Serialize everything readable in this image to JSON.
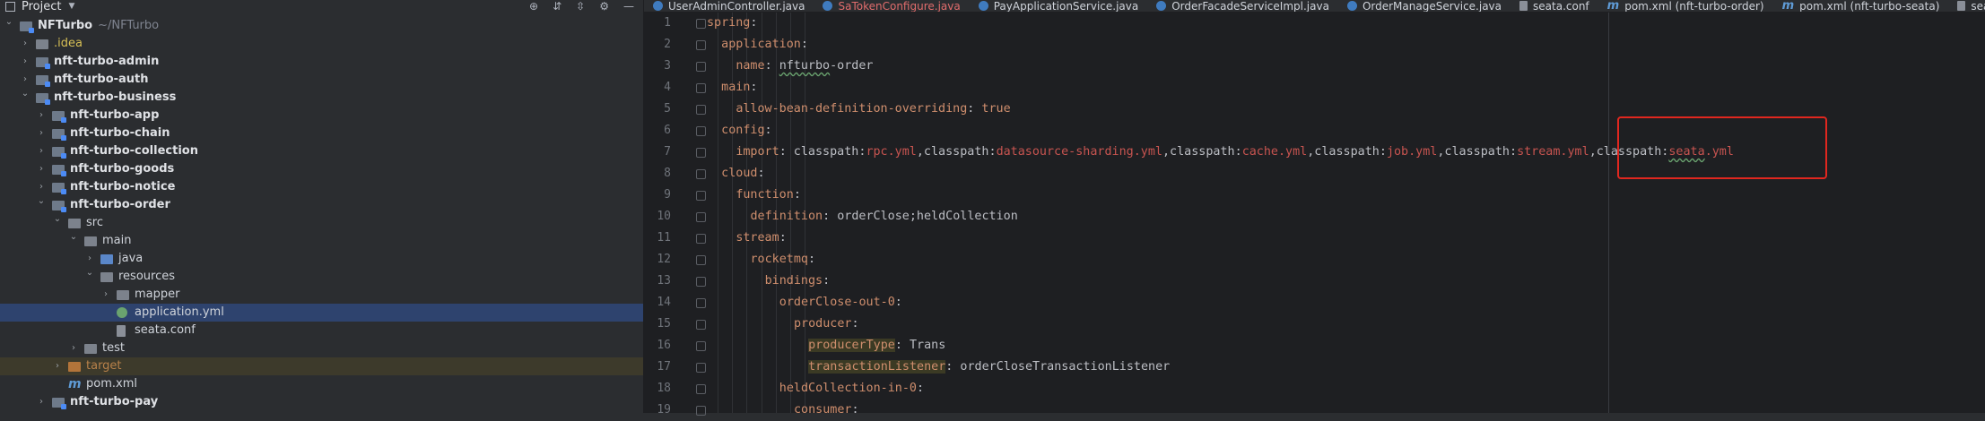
{
  "project": {
    "title": "Project",
    "tree": [
      {
        "label": "NFTurbo",
        "path": "~/NFTurbo",
        "depth": 0,
        "arrow": "open",
        "icon": "module",
        "bold": true
      },
      {
        "label": ".idea",
        "depth": 1,
        "arrow": "closed",
        "icon": "folder",
        "color": "yellow"
      },
      {
        "label": "nft-turbo-admin",
        "depth": 1,
        "arrow": "closed",
        "icon": "module",
        "bold": true
      },
      {
        "label": "nft-turbo-auth",
        "depth": 1,
        "arrow": "closed",
        "icon": "module",
        "bold": true
      },
      {
        "label": "nft-turbo-business",
        "depth": 1,
        "arrow": "open",
        "icon": "module",
        "bold": true
      },
      {
        "label": "nft-turbo-app",
        "depth": 2,
        "arrow": "closed",
        "icon": "module",
        "bold": true
      },
      {
        "label": "nft-turbo-chain",
        "depth": 2,
        "arrow": "closed",
        "icon": "module",
        "bold": true
      },
      {
        "label": "nft-turbo-collection",
        "depth": 2,
        "arrow": "closed",
        "icon": "module",
        "bold": true
      },
      {
        "label": "nft-turbo-goods",
        "depth": 2,
        "arrow": "closed",
        "icon": "module",
        "bold": true
      },
      {
        "label": "nft-turbo-notice",
        "depth": 2,
        "arrow": "closed",
        "icon": "module",
        "bold": true
      },
      {
        "label": "nft-turbo-order",
        "depth": 2,
        "arrow": "open",
        "icon": "module",
        "bold": true
      },
      {
        "label": "src",
        "depth": 3,
        "arrow": "open",
        "icon": "folder"
      },
      {
        "label": "main",
        "depth": 4,
        "arrow": "open",
        "icon": "folder"
      },
      {
        "label": "java",
        "depth": 5,
        "arrow": "closed",
        "icon": "folder-blue"
      },
      {
        "label": "resources",
        "depth": 5,
        "arrow": "open",
        "icon": "folder"
      },
      {
        "label": "mapper",
        "depth": 6,
        "arrow": "closed",
        "icon": "folder"
      },
      {
        "label": "application.yml",
        "depth": 6,
        "arrow": "none",
        "icon": "yml",
        "selected": true
      },
      {
        "label": "seata.conf",
        "depth": 6,
        "arrow": "none",
        "icon": "file"
      },
      {
        "label": "test",
        "depth": 4,
        "arrow": "closed",
        "icon": "folder"
      },
      {
        "label": "target",
        "depth": 3,
        "arrow": "closed",
        "icon": "folder-orange",
        "color": "orange",
        "excluded": true
      },
      {
        "label": "pom.xml",
        "depth": 3,
        "arrow": "none",
        "icon": "m"
      },
      {
        "label": "nft-turbo-pay",
        "depth": 2,
        "arrow": "closed",
        "icon": "module",
        "bold": true
      }
    ]
  },
  "tabs": [
    {
      "label": "UserAdminController.java",
      "icon": "class"
    },
    {
      "label": "SaTokenConfigure.java",
      "icon": "class",
      "error": true
    },
    {
      "label": "PayApplicationService.java",
      "icon": "class"
    },
    {
      "label": "OrderFacadeServiceImpl.java",
      "icon": "class"
    },
    {
      "label": "OrderManageService.java",
      "icon": "class"
    },
    {
      "label": "seata.conf",
      "icon": "conf"
    },
    {
      "label": "pom.xml (nft-turbo-order)",
      "icon": "m"
    },
    {
      "label": "pom.xml (nft-turbo-seata)",
      "icon": "m"
    },
    {
      "label": "seata.ym",
      "icon": "conf"
    }
  ],
  "editor": {
    "lines": [
      {
        "n": "1",
        "indent": 0,
        "parts": [
          [
            "k",
            "spring"
          ],
          [
            "v",
            ":"
          ]
        ]
      },
      {
        "n": "2",
        "indent": 1,
        "parts": [
          [
            "k",
            "application"
          ],
          [
            "v",
            ":"
          ]
        ]
      },
      {
        "n": "3",
        "indent": 2,
        "parts": [
          [
            "k",
            "name"
          ],
          [
            "v",
            ": "
          ],
          [
            "ul",
            "nfturbo"
          ],
          [
            "v",
            "-order"
          ]
        ]
      },
      {
        "n": "4",
        "indent": 1,
        "parts": [
          [
            "k",
            "main"
          ],
          [
            "v",
            ":"
          ]
        ]
      },
      {
        "n": "5",
        "indent": 2,
        "parts": [
          [
            "k",
            "allow-bean-definition-overriding"
          ],
          [
            "v",
            ": "
          ],
          [
            "b",
            "true"
          ]
        ]
      },
      {
        "n": "6",
        "indent": 1,
        "parts": [
          [
            "k",
            "config"
          ],
          [
            "v",
            ":"
          ]
        ]
      },
      {
        "n": "7",
        "indent": 2,
        "parts": [
          [
            "k",
            "import"
          ],
          [
            "v",
            ": classpath:"
          ],
          [
            "s",
            "rpc.yml"
          ],
          [
            "v",
            ",classpath:"
          ],
          [
            "s",
            "datasource-sharding.yml"
          ],
          [
            "v",
            ",classpath:"
          ],
          [
            "s",
            "cache.yml"
          ],
          [
            "v",
            ",classpath:"
          ],
          [
            "s",
            "job.yml"
          ],
          [
            "v",
            ",classpath:"
          ],
          [
            "s",
            "stream.yml"
          ],
          [
            "v",
            ",classpath:"
          ],
          [
            "sul",
            "seata"
          ],
          [
            "s",
            ".yml"
          ]
        ]
      },
      {
        "n": "8",
        "indent": 1,
        "parts": [
          [
            "k",
            "cloud"
          ],
          [
            "v",
            ":"
          ]
        ]
      },
      {
        "n": "9",
        "indent": 2,
        "parts": [
          [
            "k",
            "function"
          ],
          [
            "v",
            ":"
          ]
        ]
      },
      {
        "n": "10",
        "indent": 3,
        "parts": [
          [
            "k",
            "definition"
          ],
          [
            "v",
            ": orderClose;heldCollection"
          ]
        ]
      },
      {
        "n": "11",
        "indent": 2,
        "parts": [
          [
            "k",
            "stream"
          ],
          [
            "v",
            ":"
          ]
        ]
      },
      {
        "n": "12",
        "indent": 3,
        "parts": [
          [
            "k",
            "rocketmq"
          ],
          [
            "v",
            ":"
          ]
        ]
      },
      {
        "n": "13",
        "indent": 4,
        "parts": [
          [
            "k",
            "bindings"
          ],
          [
            "v",
            ":"
          ]
        ]
      },
      {
        "n": "14",
        "indent": 5,
        "parts": [
          [
            "k",
            "orderClose-out-0"
          ],
          [
            "v",
            ":"
          ]
        ]
      },
      {
        "n": "15",
        "indent": 6,
        "parts": [
          [
            "k",
            "producer"
          ],
          [
            "v",
            ":"
          ]
        ]
      },
      {
        "n": "16",
        "indent": 7,
        "parts": [
          [
            "hl",
            "producerType"
          ],
          [
            "v",
            ": Trans"
          ]
        ]
      },
      {
        "n": "17",
        "indent": 7,
        "parts": [
          [
            "hl",
            "transactionListener"
          ],
          [
            "v",
            ": orderCloseTransactionListener"
          ]
        ]
      },
      {
        "n": "18",
        "indent": 5,
        "parts": [
          [
            "k",
            "heldCollection-in-0"
          ],
          [
            "v",
            ":"
          ]
        ]
      },
      {
        "n": "19",
        "indent": 6,
        "parts": [
          [
            "k",
            "consumer"
          ],
          [
            "v",
            ":"
          ]
        ]
      }
    ]
  }
}
